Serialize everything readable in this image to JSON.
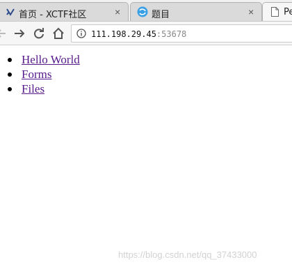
{
  "browser": {
    "tabs": [
      {
        "title": "首页 - XCTF社区",
        "favicon": "xctf-logo-icon",
        "close": "×"
      },
      {
        "title": "题目",
        "favicon": "site-logo-icon",
        "close": "×"
      },
      {
        "title": "Pe",
        "favicon": "page-icon"
      }
    ],
    "address_bar": {
      "host": "111.198.29.45",
      "port": ":53678",
      "info_icon": "info-icon"
    }
  },
  "page": {
    "links": [
      {
        "label": "Hello World"
      },
      {
        "label": "Forms"
      },
      {
        "label": "Files"
      }
    ]
  },
  "watermark": "https://blog.csdn.net/qq_37433000"
}
